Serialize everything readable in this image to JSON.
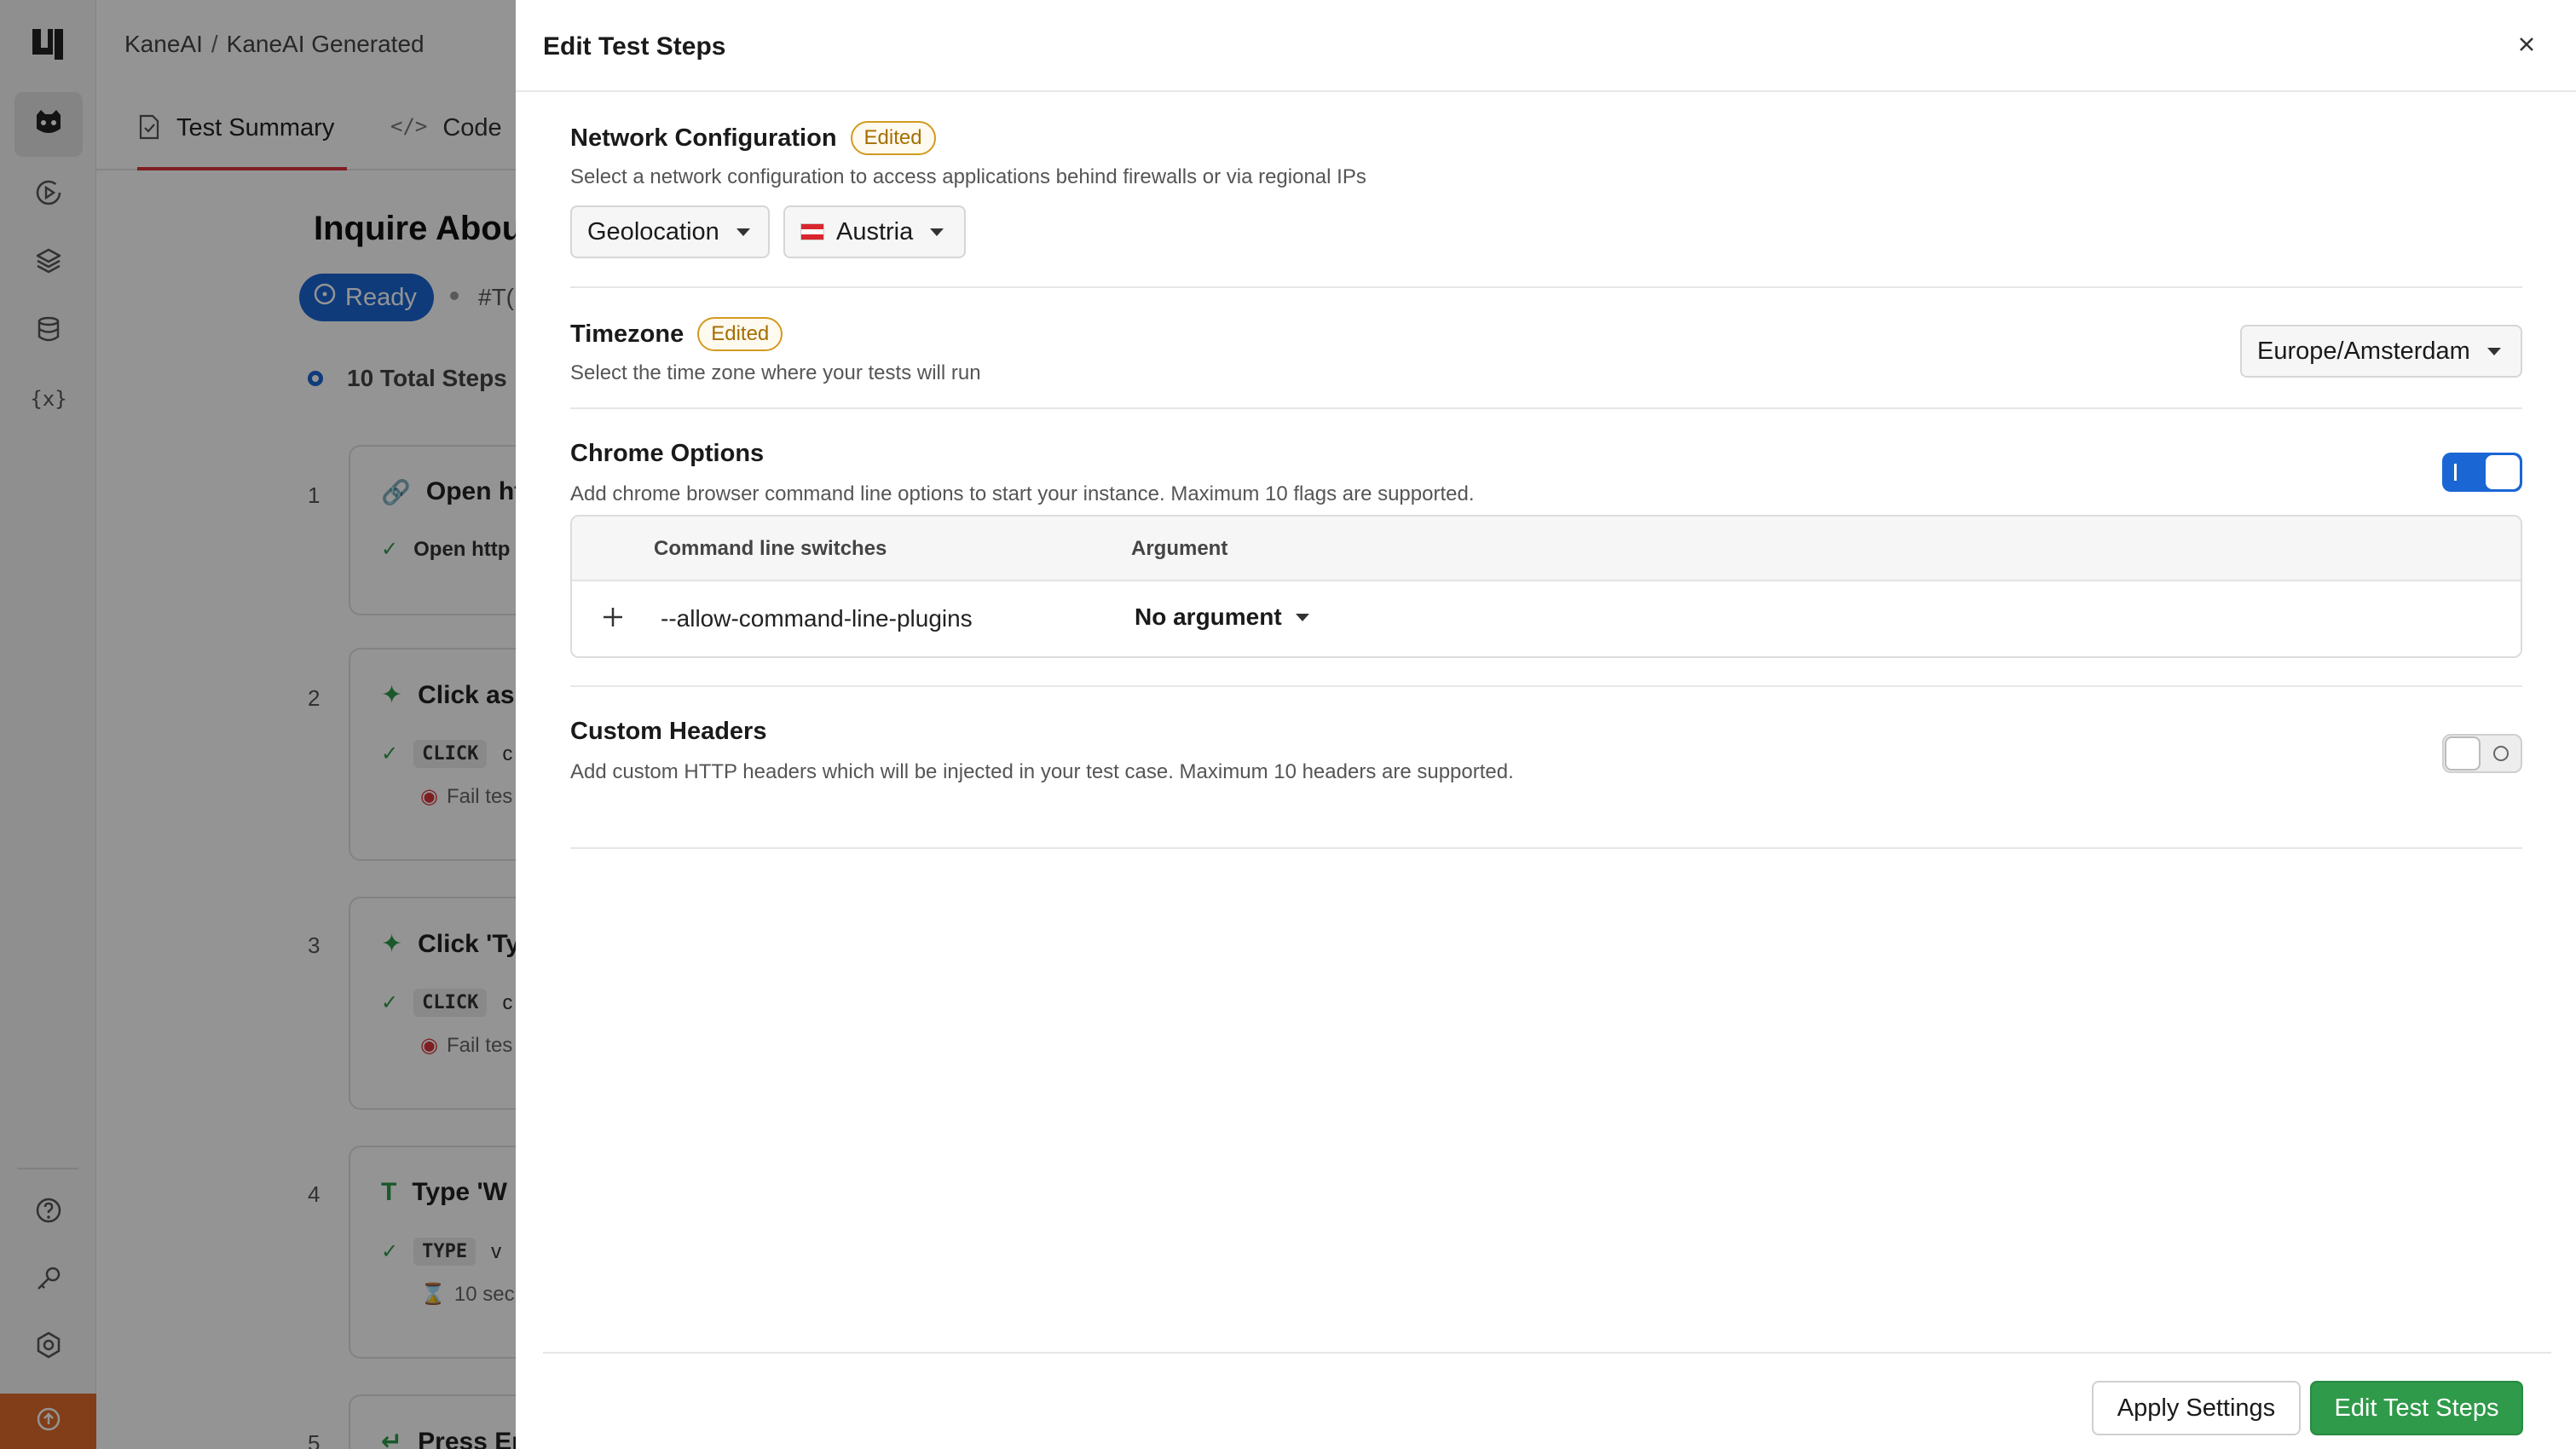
{
  "sidebar": {
    "items": [
      {
        "icon": "kane-ai-icon",
        "active": true
      },
      {
        "icon": "play-circle-icon"
      },
      {
        "icon": "layers-icon"
      },
      {
        "icon": "database-icon"
      },
      {
        "icon": "variables-icon"
      }
    ],
    "bottom_items": [
      {
        "icon": "help-icon"
      },
      {
        "icon": "key-icon"
      },
      {
        "icon": "settings-icon"
      }
    ],
    "upgrade_icon": "arrow-up-circle-icon",
    "upgrade_color": "#e06b2a"
  },
  "background": {
    "breadcrumb": {
      "part1": "KaneAI",
      "separator": "/",
      "part2": "KaneAI Generated"
    },
    "tabs": [
      {
        "label": "Test Summary",
        "active": true
      },
      {
        "label": "Code"
      }
    ],
    "page_title": "Inquire Abou",
    "status": "Ready",
    "test_id": "#T(",
    "total_steps": "10 Total Steps",
    "steps": [
      {
        "num": "1",
        "title": "Open ht",
        "line1": "Open http",
        "line2": ""
      },
      {
        "num": "2",
        "title": "Click as",
        "keyword": "CLICK",
        "line1_tail": "c",
        "line2": "Fail tes"
      },
      {
        "num": "3",
        "title": "Click 'Ty",
        "keyword": "CLICK",
        "line1_tail": "c",
        "line2": "Fail tes"
      },
      {
        "num": "4",
        "title": "Type 'W",
        "keyword": "TYPE",
        "line1_tail": "v",
        "line2": "10 sec"
      },
      {
        "num": "5",
        "title": "Press En"
      }
    ]
  },
  "drawer": {
    "title": "Edit Test Steps",
    "network": {
      "title": "Network Configuration",
      "badge": "Edited",
      "description": "Select a network configuration to access applications behind firewalls or via regional IPs",
      "mode": "Geolocation",
      "country": "Austria"
    },
    "timezone": {
      "title": "Timezone",
      "badge": "Edited",
      "description": "Select the time zone where your tests will run",
      "value": "Europe/Amsterdam"
    },
    "chrome": {
      "title": "Chrome Options",
      "description": "Add chrome browser command line options to start your instance. Maximum 10 flags are supported.",
      "enabled": true,
      "columns": {
        "switch": "Command line switches",
        "argument": "Argument"
      },
      "rows": [
        {
          "switch": "--allow-command-line-plugins",
          "argument": "No argument"
        }
      ]
    },
    "headers": {
      "title": "Custom Headers",
      "description": "Add custom HTTP headers which will be injected in your test case. Maximum 10 headers are supported.",
      "enabled": false
    },
    "buttons": {
      "apply": "Apply Settings",
      "edit": "Edit Test Steps"
    }
  },
  "colors": {
    "primary_blue": "#1a66d4",
    "primary_green": "#2f9a4a",
    "badge": "#d39a1f",
    "active_tab": "#d9363e"
  }
}
